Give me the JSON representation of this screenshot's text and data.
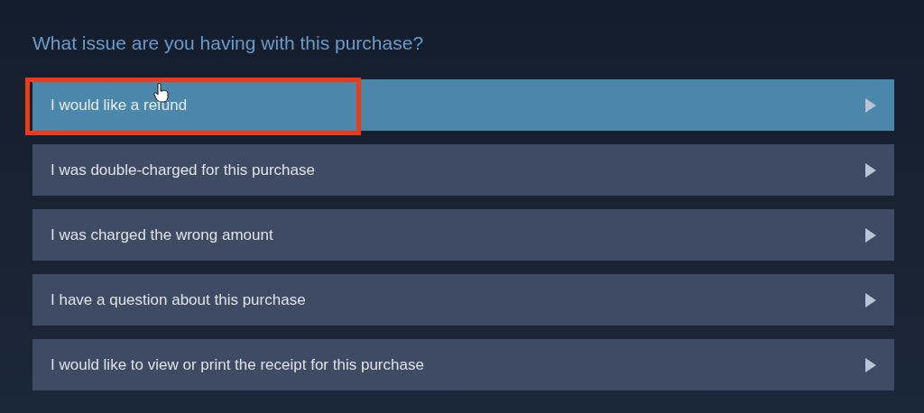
{
  "heading": "What issue are you having with this purchase?",
  "options": [
    {
      "label": "I would like a refund",
      "selected": true,
      "outlined": true,
      "pointer": true
    },
    {
      "label": "I was double-charged for this purchase",
      "selected": false,
      "outlined": false,
      "pointer": false
    },
    {
      "label": "I was charged the wrong amount",
      "selected": false,
      "outlined": false,
      "pointer": false
    },
    {
      "label": "I have a question about this purchase",
      "selected": false,
      "outlined": false,
      "pointer": false
    },
    {
      "label": "I would like to view or print the receipt for this purchase",
      "selected": false,
      "outlined": false,
      "pointer": false
    }
  ]
}
